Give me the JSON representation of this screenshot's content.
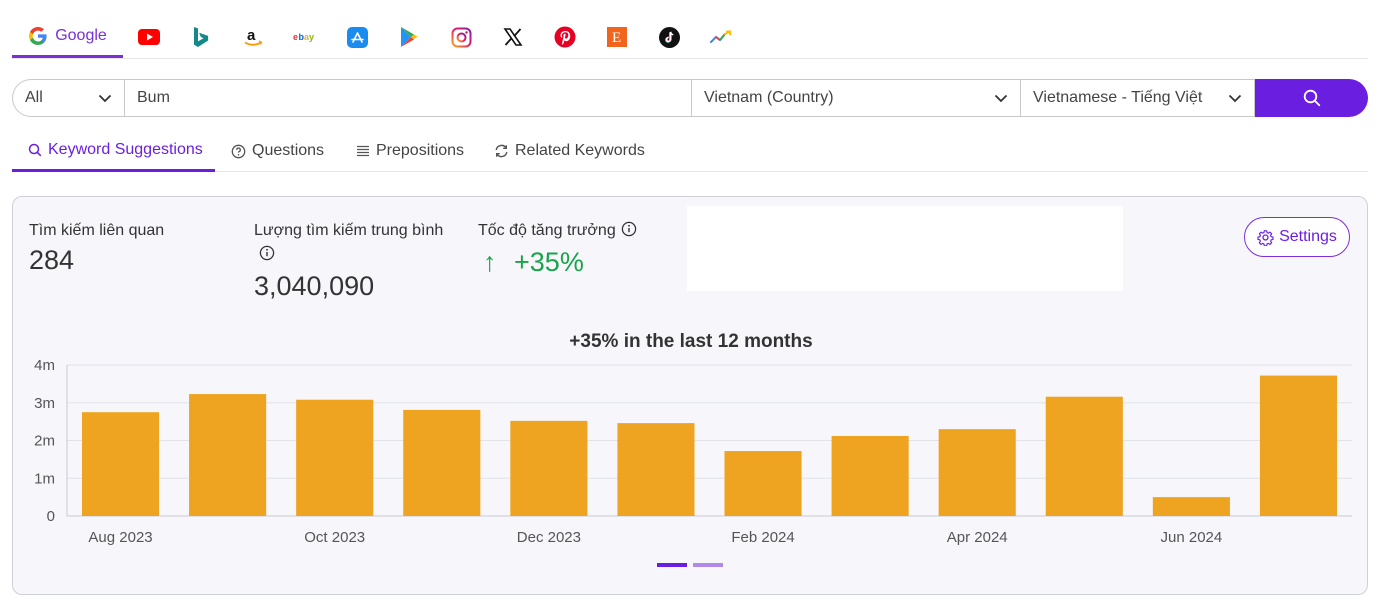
{
  "engines": [
    {
      "name": "google",
      "label": "Google",
      "active": true
    },
    {
      "name": "youtube"
    },
    {
      "name": "bing"
    },
    {
      "name": "amazon"
    },
    {
      "name": "ebay",
      "label": "ebay"
    },
    {
      "name": "app-store"
    },
    {
      "name": "google-play"
    },
    {
      "name": "instagram"
    },
    {
      "name": "x"
    },
    {
      "name": "pinterest"
    },
    {
      "name": "etsy",
      "label": "E"
    },
    {
      "name": "tiktok"
    },
    {
      "name": "trends"
    }
  ],
  "search": {
    "type_value": "All",
    "query": "Bum",
    "country": "Vietnam (Country)",
    "language": "Vietnamese - Tiếng Việt"
  },
  "subtabs": [
    "Keyword Suggestions",
    "Questions",
    "Prepositions",
    "Related Keywords"
  ],
  "stats": {
    "related_label": "Tìm kiếm liên quan",
    "related_value": "284",
    "avg_label": "Lượng tìm kiếm trung bình",
    "avg_value": "3,040,090",
    "growth_label": "Tốc độ tăng trưởng",
    "growth_value": "+35%",
    "growth_arrow": "↑"
  },
  "settings_label": "Settings",
  "colors": {
    "accent": "#6a1fe0",
    "bar": "#eea420",
    "growth": "#1aa34a"
  },
  "chart_data": {
    "type": "bar",
    "title": "+35% in the last 12 months",
    "categories": [
      "Aug 2023",
      "Sep 2023",
      "Oct 2023",
      "Nov 2023",
      "Dec 2023",
      "Jan 2024",
      "Feb 2024",
      "Mar 2024",
      "Apr 2024",
      "May 2024",
      "Jun 2024",
      "Jul 2024"
    ],
    "tick_labels": [
      "Aug 2023",
      "Oct 2023",
      "Dec 2023",
      "Feb 2024",
      "Apr 2024",
      "Jun 2024"
    ],
    "values": [
      2750000,
      3230000,
      3080000,
      2810000,
      2520000,
      2460000,
      1720000,
      2120000,
      2300000,
      3160000,
      500000,
      3720000
    ],
    "ylim": [
      0,
      4000000
    ],
    "y_ticks": [
      "0",
      "1m",
      "2m",
      "3m",
      "4m"
    ],
    "grid": true
  },
  "pager": {
    "pages": 2,
    "active": 1
  }
}
